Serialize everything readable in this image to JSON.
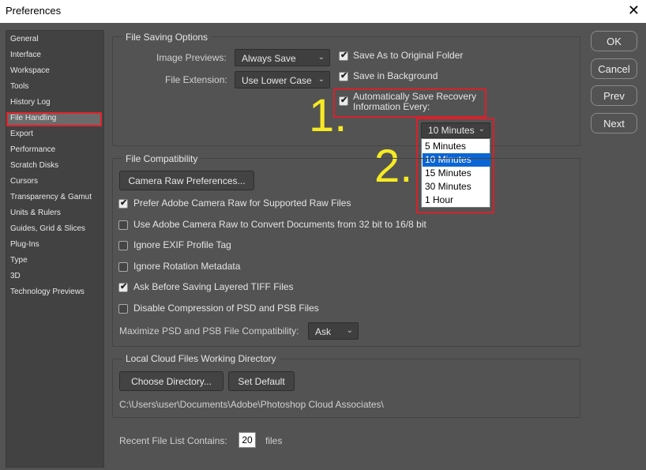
{
  "window": {
    "title": "Preferences",
    "close_glyph": "✕"
  },
  "sidebar": {
    "items": [
      "General",
      "Interface",
      "Workspace",
      "Tools",
      "History Log",
      "File Handling",
      "Export",
      "Performance",
      "Scratch Disks",
      "Cursors",
      "Transparency & Gamut",
      "Units & Rulers",
      "Guides, Grid & Slices",
      "Plug-Ins",
      "Type",
      "3D",
      "Technology Previews"
    ],
    "selected": "File Handling"
  },
  "buttons": {
    "ok": "OK",
    "cancel": "Cancel",
    "prev": "Prev",
    "next": "Next"
  },
  "file_saving": {
    "title": "File Saving Options",
    "image_previews_label": "Image Previews:",
    "image_previews_value": "Always Save",
    "file_extension_label": "File Extension:",
    "file_extension_value": "Use Lower Case",
    "save_as_original": "Save As to Original Folder",
    "save_in_background": "Save in Background",
    "auto_save_line1": "Automatically Save Recovery",
    "auto_save_line2": "Information Every:",
    "interval_value": "10 Minutes",
    "interval_options": [
      "5 Minutes",
      "10 Minutes",
      "15 Minutes",
      "30 Minutes",
      "1 Hour"
    ],
    "interval_selected_index": 1
  },
  "compat": {
    "title": "File Compatibility",
    "camera_raw_button": "Camera Raw Preferences...",
    "checkboxes": [
      {
        "label": "Prefer Adobe Camera Raw for Supported Raw Files",
        "checked": true
      },
      {
        "label": "Use Adobe Camera Raw to Convert Documents from 32 bit to 16/8 bit",
        "checked": false
      },
      {
        "label": "Ignore EXIF Profile Tag",
        "checked": false
      },
      {
        "label": "Ignore Rotation Metadata",
        "checked": false
      },
      {
        "label": "Ask Before Saving Layered TIFF Files",
        "checked": true
      },
      {
        "label": "Disable Compression of PSD and PSB Files",
        "checked": false
      }
    ],
    "maximize_label": "Maximize PSD and PSB File Compatibility:",
    "maximize_value": "Ask"
  },
  "cloud": {
    "title": "Local Cloud Files Working Directory",
    "choose_button": "Choose Directory...",
    "default_button": "Set Default",
    "path": "C:\\Users\\user\\Documents\\Adobe\\Photoshop Cloud Associates\\"
  },
  "recent": {
    "label": "Recent File List Contains:",
    "value": "20",
    "suffix": "files"
  },
  "annotations": {
    "step1": "1.",
    "step2": "2."
  },
  "colors": {
    "highlight_red": "#d8202b",
    "annotation_yellow": "#f6ea23",
    "selection_blue": "#0a66d4"
  },
  "icons": {
    "checkbox_checked": "✔",
    "dropdown_chevron": "⌄",
    "close": "✕"
  }
}
